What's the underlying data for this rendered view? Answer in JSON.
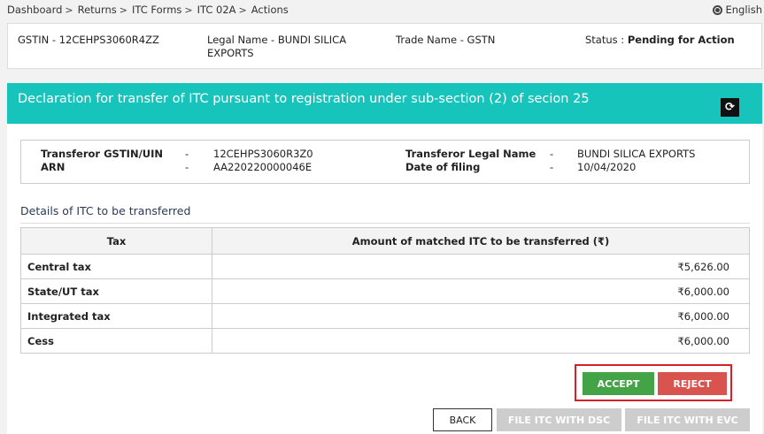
{
  "breadcrumb": [
    {
      "label": "Dashboard"
    },
    {
      "label": "Returns"
    },
    {
      "label": "ITC Forms"
    },
    {
      "label": "ITC 02A"
    },
    {
      "label": "Actions"
    }
  ],
  "breadcrumb_sep": ">",
  "language": "English",
  "header": {
    "gstin": "GSTIN - 12CEHPS3060R4ZZ",
    "legal_name": "Legal Name - BUNDI SILICA EXPORTS",
    "trade_name": "Trade Name - GSTN",
    "status_label": "Status : ",
    "status_value": "Pending for Action"
  },
  "banner": {
    "title": "Declaration for transfer of ITC pursuant to registration under sub-section (2) of secion 25",
    "refresh_icon": "refresh-icon"
  },
  "transferor": {
    "gstin_label": "Transferor GSTIN/UIN",
    "gstin_value": "12CEHPS3060R3Z0",
    "arn_label": "ARN",
    "arn_value": "AA220220000046E",
    "legal_name_label": "Transferor Legal Name",
    "legal_name_value": "BUNDI SILICA EXPORTS",
    "date_label": "Date of filing",
    "date_value": "10/04/2020",
    "dash": "-"
  },
  "details_title": "Details of ITC to be transferred",
  "table": {
    "headers": [
      "Tax",
      "Amount of matched ITC to be transferred (₹)"
    ],
    "rows": [
      {
        "tax": "Central tax",
        "amount": "₹5,626.00"
      },
      {
        "tax": "State/UT tax",
        "amount": "₹6,000.00"
      },
      {
        "tax": "Integrated tax",
        "amount": "₹6,000.00"
      },
      {
        "tax": "Cess",
        "amount": "₹6,000.00"
      }
    ]
  },
  "buttons": {
    "accept": "ACCEPT",
    "reject": "REJECT",
    "back": "BACK",
    "file_dsc": "FILE ITC WITH DSC",
    "file_evc": "FILE ITC WITH EVC"
  },
  "colors": {
    "banner": "#17c4bb",
    "accept": "#44a247",
    "reject": "#d9534f",
    "highlight_border": "#d61f26",
    "disabled": "#cdcdcd"
  }
}
